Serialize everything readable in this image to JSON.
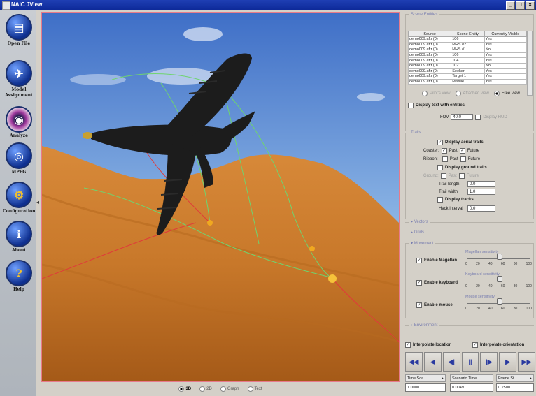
{
  "window": {
    "title": "NAIC JView",
    "controls": [
      "_",
      "□",
      "×"
    ]
  },
  "nav": [
    {
      "id": "open",
      "label": "Open File",
      "glyph": "▤"
    },
    {
      "id": "model",
      "label": "Model Assignment",
      "glyph": "✈"
    },
    {
      "id": "analyze",
      "label": "Analyze",
      "glyph": "◉"
    },
    {
      "id": "mpeg",
      "label": "MPEG",
      "glyph": "◎"
    },
    {
      "id": "config",
      "label": "Configuration",
      "glyph": "⚙"
    },
    {
      "id": "about",
      "label": "About",
      "glyph": "i"
    },
    {
      "id": "help",
      "label": "Help",
      "glyph": "?"
    }
  ],
  "view_modes": {
    "items": [
      "3D",
      "2D",
      "Graph",
      "Text"
    ],
    "selected": "3D"
  },
  "scene_entities": {
    "title": "Scene Entities",
    "columns": [
      "Source",
      "Scene Entity",
      "Currently Visible"
    ],
    "rows": [
      [
        "demo009.aftr (0)",
        "106",
        "Yes"
      ],
      [
        "demo009.aftr (0)",
        "MHS #2",
        "Yes"
      ],
      [
        "demo009.aftr (0)",
        "MHS #1",
        "No"
      ],
      [
        "demo009.aftr (0)",
        "106",
        "Yes"
      ],
      [
        "demo009.aftr (0)",
        "104",
        "Yes"
      ],
      [
        "demo009.aftr (0)",
        "102",
        "No"
      ],
      [
        "demo009.aftr (0)",
        "Seeker",
        "Yes"
      ],
      [
        "demo009.aftr (0)",
        "Target 1",
        "Yes"
      ],
      [
        "demo009.aftr (0)",
        "Missile",
        "Yes"
      ]
    ],
    "view_options": [
      "Pilot's view",
      "Attached view",
      "Free view"
    ],
    "selected_view": "Free view",
    "display_text_label": "Display text with entities",
    "fov_label": "FOV",
    "fov_value": "40.0",
    "display_hud_label": "Display HUD"
  },
  "trails": {
    "title": "Trails",
    "display_aerial": "Display aerial trails",
    "coaster_label": "Coaster:",
    "ribbon_label": "Ribbon:",
    "past": "Past",
    "future": "Future",
    "display_ground": "Display ground trails",
    "ground_label": "Ground:",
    "trail_length_label": "Trail length",
    "trail_length_value": "0.0",
    "trail_width_label": "Trail width",
    "trail_width_value": "1.0",
    "display_tracks": "Display tracks",
    "hack_interval_label": "Hack interval",
    "hack_interval_value": "0.0"
  },
  "collapsed_sections": [
    "Vectors",
    "Grids"
  ],
  "movement": {
    "title": "Movement",
    "magellan": {
      "label": "Enable Magellan",
      "slider_title": "Magellan sensitivity",
      "value": 50
    },
    "keyboard": {
      "label": "Enable keyboard",
      "slider_title": "Keyboard sensitivity",
      "value": 50
    },
    "mouse": {
      "label": "Enable mouse",
      "slider_title": "Mouse sensitivity",
      "value": 50
    },
    "ticks": [
      "0",
      "20",
      "40",
      "60",
      "80",
      "100"
    ]
  },
  "environment_title": "Environment",
  "interpolate_location": "Interpolate location",
  "interpolate_orientation": "Interpolate orientation",
  "transport": [
    "◀◀",
    "◀",
    "◀|",
    "||",
    "|▶",
    "▶",
    "▶▶"
  ],
  "time_fields": [
    {
      "label": "Time Sca...",
      "value": "1.0000"
    },
    {
      "label": "Scenario Time",
      "value": "0.0049"
    },
    {
      "label": "Frame St...",
      "value": "0.2500"
    }
  ],
  "colors": {
    "accent": "#1f3fb4",
    "terrain": "#c8782a",
    "sky": "#8fb8e6",
    "viewport_border": "#e87a8a"
  }
}
